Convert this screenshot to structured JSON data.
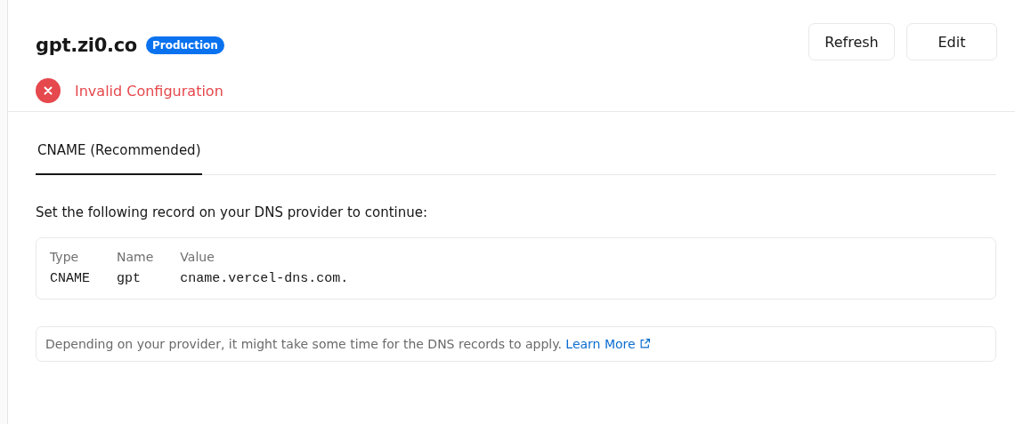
{
  "domain": {
    "name": "gpt.zi0.co",
    "badge": "Production"
  },
  "buttons": [
    {
      "label": "Refresh"
    },
    {
      "label": "Edit"
    }
  ],
  "status": {
    "kind": "error",
    "text": "Invalid Configuration"
  },
  "tabs": [
    {
      "label": "CNAME (Recommended)",
      "selected": true
    }
  ],
  "instruction": "Set the following record on your DNS provider to continue:",
  "record": {
    "columns": [
      "Type",
      "Name",
      "Value"
    ],
    "values": [
      "CNAME",
      "gpt",
      "cname.vercel-dns.com."
    ]
  },
  "note": {
    "text": "Depending on your provider, it might take some time for the DNS records to apply.",
    "link": "Learn More"
  }
}
